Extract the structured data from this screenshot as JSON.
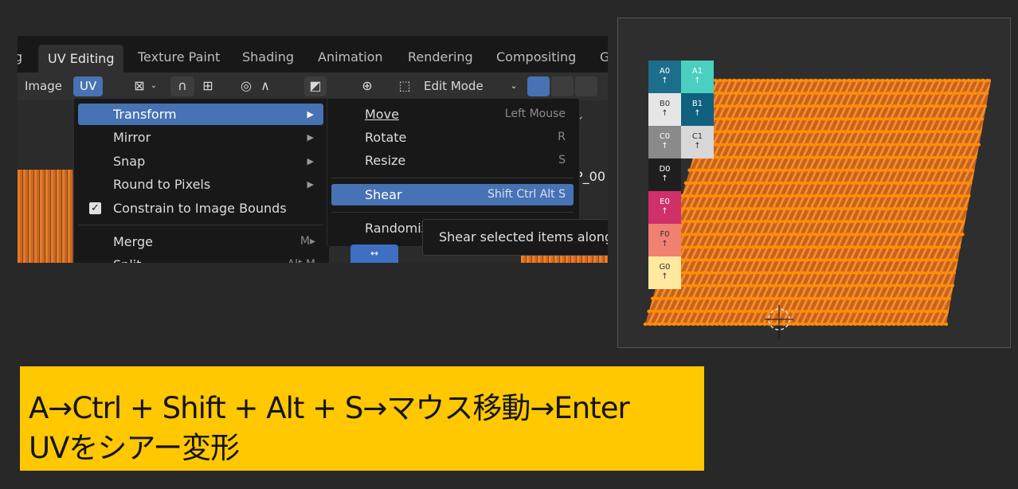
{
  "workspace_tabs": [
    {
      "label": "g",
      "active": false
    },
    {
      "label": "UV Editing",
      "active": true
    },
    {
      "label": "Texture Paint",
      "active": false
    },
    {
      "label": "Shading",
      "active": false
    },
    {
      "label": "Animation",
      "active": false
    },
    {
      "label": "Rendering",
      "active": false
    },
    {
      "label": "Compositing",
      "active": false
    },
    {
      "label": "G",
      "active": false
    }
  ],
  "header": {
    "image_menu": "Image",
    "uv_menu": "UV",
    "mode": "Edit Mode",
    "viewport_fragment": "P_00"
  },
  "uv_menu_items": [
    {
      "label": "Transform",
      "submenu": true,
      "highlighted": true
    },
    {
      "label": "Mirror",
      "submenu": true
    },
    {
      "label": "Snap",
      "submenu": true
    },
    {
      "label": "Round to Pixels",
      "submenu": true
    },
    {
      "label": "Constrain to Image Bounds",
      "checkbox": true,
      "checked": true
    },
    {
      "label": "Merge",
      "shortcut": "M▸"
    },
    {
      "label": "Split",
      "shortcut": "Alt M"
    }
  ],
  "transform_submenu": [
    {
      "label": "Move",
      "shortcut": "Left Mouse"
    },
    {
      "label": "Rotate",
      "shortcut": "R"
    },
    {
      "label": "Resize",
      "shortcut": "S"
    },
    {
      "label": "Shear",
      "shortcut": "Shift Ctrl Alt S",
      "highlighted": true
    },
    {
      "label": "Randomiz"
    }
  ],
  "tooltip": "Shear selected items along",
  "uv_grid_labels": [
    {
      "row": "A0",
      "col2": "A1",
      "color": "#1c6f8c",
      "color2": "#4bd0c0"
    },
    {
      "row": "B0",
      "col2": "B1",
      "color": "#e6e6e6",
      "color2": "#106080"
    },
    {
      "row": "C0",
      "col2": "C1",
      "color": "#8a8a8a",
      "color2": "#d8d8d8"
    },
    {
      "row": "D0",
      "col2": "",
      "color": "#1e1e1e",
      "color2": ""
    },
    {
      "row": "E0",
      "col2": "",
      "color": "#d0306a",
      "color2": ""
    },
    {
      "row": "F0",
      "col2": "",
      "color": "#f08070",
      "color2": ""
    },
    {
      "row": "G0",
      "col2": "",
      "color": "#ffe8a0",
      "color2": ""
    }
  ],
  "caption": {
    "line1": "A→Ctrl + Shift + Alt + S→マウス移動→Enter",
    "line2": "UVをシアー変形"
  },
  "colors": {
    "accent": "#4772b3",
    "caption_bg": "#ffc800",
    "uv_orange": "#f08020"
  }
}
